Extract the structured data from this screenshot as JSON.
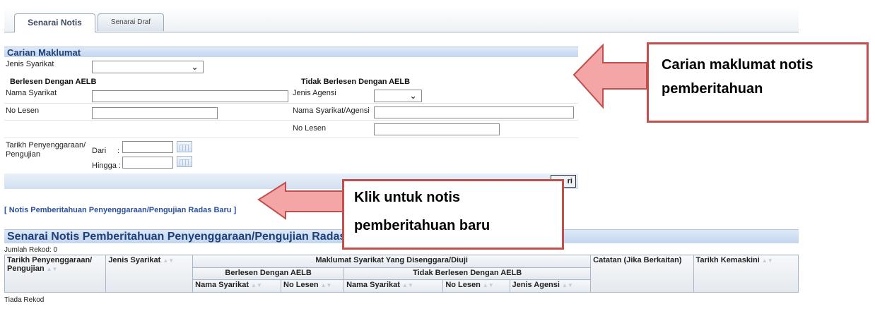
{
  "tabs": [
    {
      "label": "Senarai Notis",
      "active": true
    },
    {
      "label": "Senarai Draf",
      "active": false
    }
  ],
  "search": {
    "title": "Carian Maklumat",
    "jenis_syarikat_label": "Jenis Syarikat",
    "jenis_syarikat_value": "",
    "licensed_heading": "Berlesen Dengan AELB",
    "unlicensed_heading": "Tidak Berlesen Dengan AELB",
    "nama_syarikat_label": "Nama Syarikat",
    "no_lesen_label": "No Lesen",
    "jenis_agensi_label": "Jenis Agensi",
    "jenis_agensi_value": "",
    "nama_syarikat_agensi_label": "Nama Syarikat/Agensi",
    "no_lesen2_label": "No Lesen",
    "tarikh_label": "Tarikh Penyenggaraan/ Pengujian",
    "dari_label": "Dari",
    "hingga_label": "Hingga :",
    "colon": ":",
    "search_button_label": "ri"
  },
  "new_notice_link": "[ Notis Pemberitahuan Penyenggaraan/Pengujian Radas Baru ]",
  "list": {
    "title": "Senarai Notis Pemberitahuan Penyenggaraan/Pengujian Radas",
    "record_count": "Jumlah Rekod: 0",
    "columns": {
      "tarikh": "Tarikh Penyenggaraan/ Pengujian",
      "jenis_syarikat": "Jenis Syarikat",
      "maklumat": "Maklumat Syarikat Yang Disenggara/Diuji",
      "berlesen": "Berlesen Dengan AELB",
      "tidak_berlesen": "Tidak Berlesen Dengan AELB",
      "nama_syarikat": "Nama Syarikat",
      "no_lesen": "No Lesen",
      "nama_syarikat2": "Nama Syarikat",
      "no_lesen2": "No Lesen",
      "jenis_agensi": "Jenis Agensi",
      "catatan": "Catatan (Jika Berkaitan)",
      "tarikh_kemaskini": "Tarikh Kemaskini"
    },
    "empty_text": "Tiada Rekod"
  },
  "callouts": {
    "search_note": "Carian maklumat notis pemberitahuan",
    "new_note_line1": "Klik untuk notis",
    "new_note_line2": "pemberitahuan baru"
  },
  "colors": {
    "callout_border": "#c0504d",
    "arrow_fill": "#f4a6a6",
    "header_blue": "#1f3f7a"
  }
}
